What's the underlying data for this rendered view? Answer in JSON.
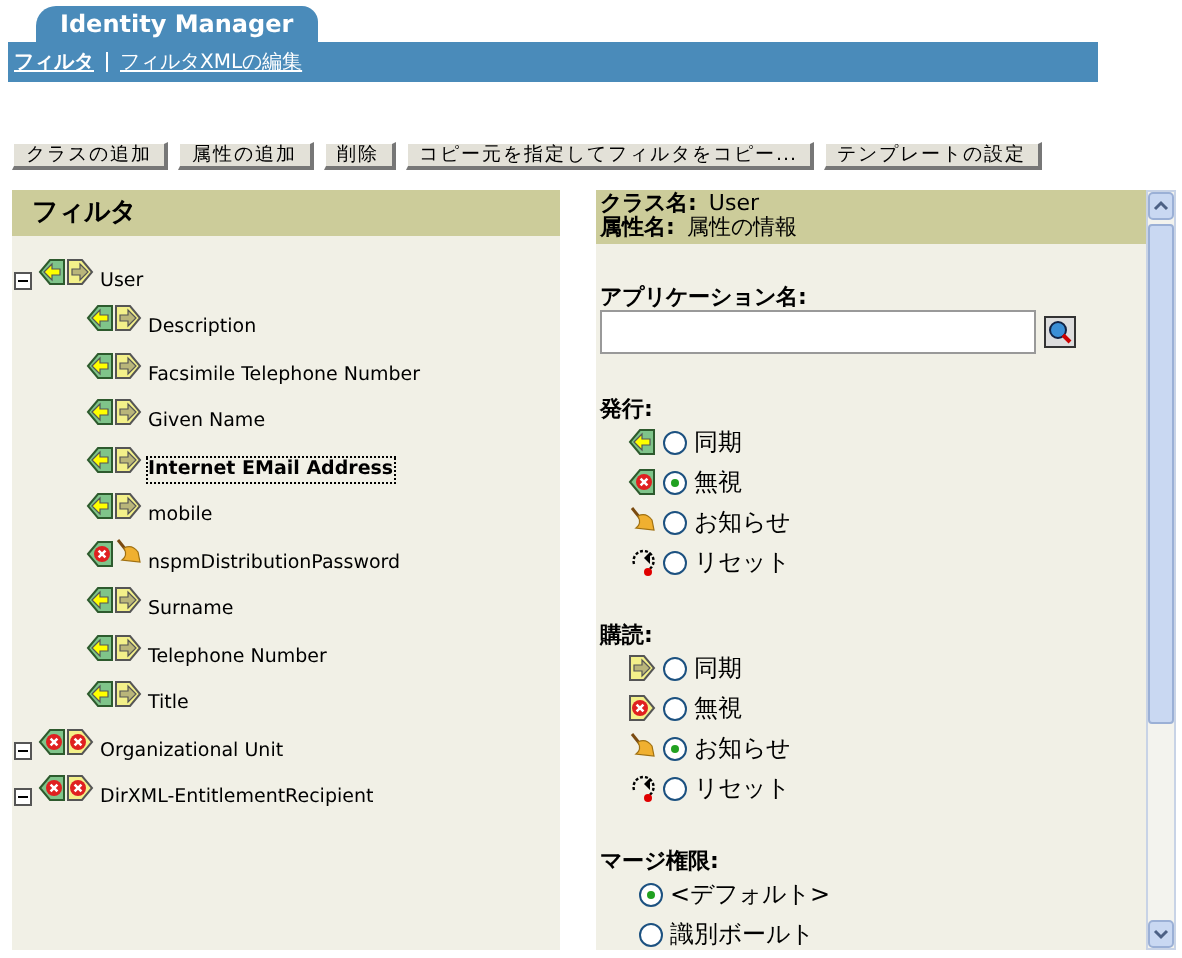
{
  "app_tab": {
    "title": "Identity Manager"
  },
  "nav_links": [
    {
      "label": "フィルタ",
      "selected": true
    },
    {
      "label": "フィルタXMLの編集",
      "selected": false
    }
  ],
  "toolbar_buttons": [
    "クラスの追加",
    "属性の追加",
    "削除",
    "コピー元を指定してフィルタをコピー...",
    "テンプレートの設定"
  ],
  "filter_panel": {
    "title": "フィルタ",
    "tree": [
      {
        "label": "User",
        "expanded": true,
        "kind": "sync",
        "selected": false,
        "children": [
          {
            "label": "Description",
            "kind": "sync",
            "selected": false
          },
          {
            "label": "Facsimile Telephone Number",
            "kind": "sync",
            "selected": false
          },
          {
            "label": "Given Name",
            "kind": "sync",
            "selected": false
          },
          {
            "label": "Internet EMail Address",
            "kind": "sync",
            "selected": true
          },
          {
            "label": "mobile",
            "kind": "sync",
            "selected": false
          },
          {
            "label": "nspmDistributionPassword",
            "kind": "notify",
            "selected": false
          },
          {
            "label": "Surname",
            "kind": "sync",
            "selected": false
          },
          {
            "label": "Telephone Number",
            "kind": "sync",
            "selected": false
          },
          {
            "label": "Title",
            "kind": "sync",
            "selected": false
          }
        ]
      },
      {
        "label": "Organizational Unit",
        "expanded": true,
        "kind": "ignore",
        "selected": false
      },
      {
        "label": "DirXML-EntitlementRecipient",
        "expanded": true,
        "kind": "ignore",
        "selected": false
      }
    ]
  },
  "detail_panel": {
    "class_label": "クラス名:",
    "class_value": "User",
    "attribute_label": "属性名:",
    "attribute_value": "属性の情報",
    "application_name": {
      "label": "アプリケーション名:"
    },
    "groups": [
      {
        "title": "発行:",
        "options": [
          {
            "kind": "pubsync",
            "label": "同期",
            "selected": false
          },
          {
            "kind": "pubignore",
            "label": "無視",
            "selected": true
          },
          {
            "kind": "notify",
            "label": "お知らせ",
            "selected": false
          },
          {
            "kind": "reset",
            "label": "リセット",
            "selected": false
          }
        ]
      },
      {
        "title": "購読:",
        "options": [
          {
            "kind": "subsync",
            "label": "同期",
            "selected": false
          },
          {
            "kind": "subignore",
            "label": "無視",
            "selected": false
          },
          {
            "kind": "notify",
            "label": "お知らせ",
            "selected": true
          },
          {
            "kind": "reset",
            "label": "リセット",
            "selected": false
          }
        ]
      },
      {
        "title": "マージ権限:",
        "options": [
          {
            "kind": "plain",
            "label": "<デフォルト>",
            "selected": true
          },
          {
            "kind": "plain",
            "label": "識別ボールト",
            "selected": false
          }
        ]
      }
    ]
  }
}
